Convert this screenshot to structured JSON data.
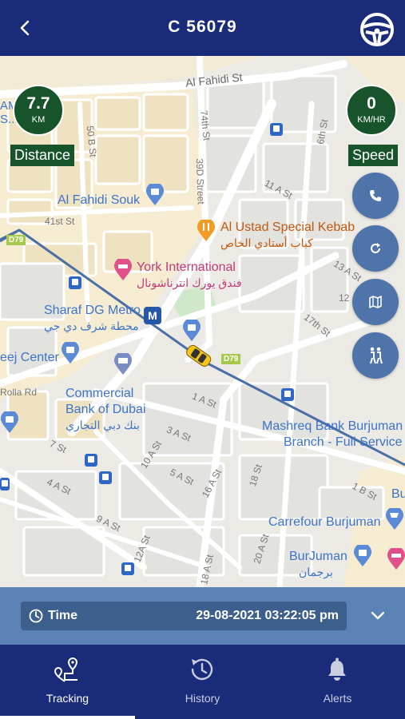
{
  "header": {
    "title": "C 56079"
  },
  "stats": {
    "distance": {
      "value": "7.7",
      "unit": "KM",
      "label": "Distance"
    },
    "speed": {
      "value": "0",
      "unit": "KM/HR",
      "label": "Speed"
    }
  },
  "map": {
    "labels": {
      "al_fahidi_st": "Al Fahidi St",
      "st_74": "74th St",
      "st_6": "6th St",
      "st_50b": "50 B St",
      "st_39d": "39D Street",
      "st_11a": "11 A St",
      "st_41": "41st St",
      "st_13a": "13 A St",
      "st_12": "12",
      "st_17": "17th St",
      "rolla": "Rolla Rd",
      "st_1a": "1 A St",
      "st_3a": "3 A St",
      "st_10a": "10 A St",
      "st_5a": "5 A St",
      "st_16a": "16 A St",
      "st_18": "18 St",
      "st_7": "7 St",
      "st_4a": "4 A St",
      "st_9a": "9 A St",
      "st_12a": "12A St",
      "st_18a": "18 A St",
      "st_20a": "20 A St",
      "st_1b": "1 B St",
      "d79_left": "D79",
      "d79_mid": "D79",
      "am_s": "AM\nS...",
      "al_fahidi_souk": "Al Fahidi Souk",
      "al_ustad": "Al Ustad Special Kebab",
      "al_ustad_ar": "كباب أستادي الخاص",
      "york": "York International",
      "york_ar": "فندق يورك انترناشونال",
      "sharaf": "Sharaf DG Metro",
      "sharaf_ar": "محطة شرف دي جي",
      "eej_center": "eej Center",
      "commercial": "Commercial",
      "bank_dubai": "Bank of Dubai",
      "bank_ar": "بنك دبي التجاري",
      "mashreq1": "Mashreq Bank Burjuman",
      "mashreq2": "Branch - Full Service",
      "carrefour": "Carrefour Burjuman",
      "burjuman": "BurJuman",
      "burjuman_ar": "برجمان",
      "bu": "Bu",
      "metro_m": "M"
    }
  },
  "fabs": [
    {
      "name": "call-button",
      "icon": "phone-icon"
    },
    {
      "name": "refresh-button",
      "icon": "refresh-icon"
    },
    {
      "name": "map-type-button",
      "icon": "map-icon"
    },
    {
      "name": "street-view-button",
      "icon": "walking-people-icon"
    }
  ],
  "time": {
    "label": "Time",
    "value": "29-08-2021 03:22:05 pm"
  },
  "tabs": [
    {
      "label": "Tracking",
      "active": true
    },
    {
      "label": "History",
      "active": false
    },
    {
      "label": "Alerts",
      "active": false
    }
  ],
  "colors": {
    "header": "#1a2b7a",
    "stat_badge": "#17532b",
    "fab": "#4e74aa",
    "time_bar": "#5a82b5",
    "route": "#4a6fa5",
    "car": "#f5c518"
  }
}
